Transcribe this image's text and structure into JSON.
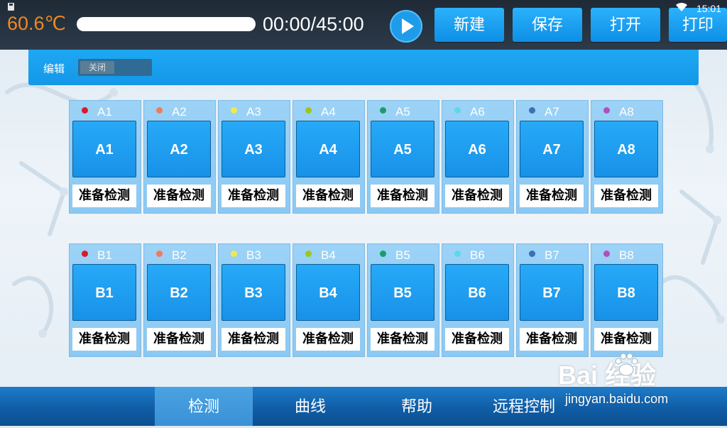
{
  "header": {
    "temperature": "60.6℃",
    "progress": 0.0,
    "timecode": "00:00/45:00",
    "clock": "15:01",
    "buttons": {
      "new": "新建",
      "save": "保存",
      "open": "打开",
      "print": "打印"
    }
  },
  "editbar": {
    "label": "编辑",
    "toggle_state": "关闭"
  },
  "wells": {
    "row_a": [
      {
        "name": "A1",
        "button": "A1",
        "status": "准备检测",
        "dot_color": "#d81b2a"
      },
      {
        "name": "A2",
        "button": "A2",
        "status": "准备检测",
        "dot_color": "#f27a5a"
      },
      {
        "name": "A3",
        "button": "A3",
        "status": "准备检测",
        "dot_color": "#f2e94a"
      },
      {
        "name": "A4",
        "button": "A4",
        "status": "准备检测",
        "dot_color": "#9dc61e"
      },
      {
        "name": "A5",
        "button": "A5",
        "status": "准备检测",
        "dot_color": "#1a9c6a"
      },
      {
        "name": "A6",
        "button": "A6",
        "status": "准备检测",
        "dot_color": "#5fd7e8"
      },
      {
        "name": "A7",
        "button": "A7",
        "status": "准备检测",
        "dot_color": "#3a6fb8"
      },
      {
        "name": "A8",
        "button": "A8",
        "status": "准备检测",
        "dot_color": "#b44fb8"
      }
    ],
    "row_b": [
      {
        "name": "B1",
        "button": "B1",
        "status": "准备检测",
        "dot_color": "#d81b2a"
      },
      {
        "name": "B2",
        "button": "B2",
        "status": "准备检测",
        "dot_color": "#f27a5a"
      },
      {
        "name": "B3",
        "button": "B3",
        "status": "准备检测",
        "dot_color": "#f2e94a"
      },
      {
        "name": "B4",
        "button": "B4",
        "status": "准备检测",
        "dot_color": "#9dc61e"
      },
      {
        "name": "B5",
        "button": "B5",
        "status": "准备检测",
        "dot_color": "#1a9c6a"
      },
      {
        "name": "B6",
        "button": "B6",
        "status": "准备检测",
        "dot_color": "#5fd7e8"
      },
      {
        "name": "B7",
        "button": "B7",
        "status": "准备检测",
        "dot_color": "#3a6fb8"
      },
      {
        "name": "B8",
        "button": "B8",
        "status": "准备检测",
        "dot_color": "#b44fb8"
      }
    ]
  },
  "nav": {
    "tabs": [
      "检测",
      "曲线",
      "帮助",
      "远程控制"
    ],
    "active": "检测"
  },
  "watermark": {
    "logo": "Bai  经验",
    "url": "jingyan.baidu.com"
  },
  "colors": {
    "accent": "#1ea8f3",
    "temperature": "#f08a1c",
    "topbar": "#263443"
  }
}
